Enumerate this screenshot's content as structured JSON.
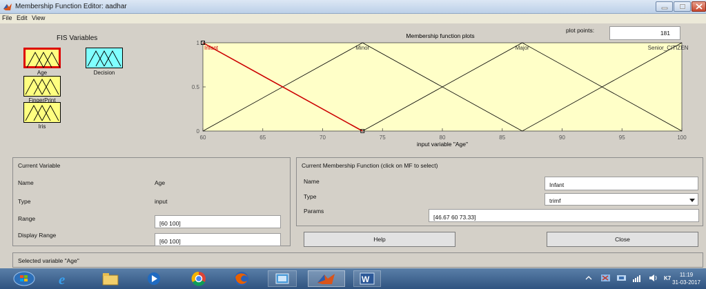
{
  "window": {
    "title": "Membership Function Editor: aadhar",
    "icons": {
      "app": "matlab-icon",
      "minimize": "minimize-icon",
      "maximize": "maximize-icon",
      "close": "close-icon"
    }
  },
  "menu": {
    "items": [
      "File",
      "Edit",
      "View"
    ]
  },
  "fis": {
    "title": "FIS Variables",
    "variables": [
      {
        "label": "Age",
        "selected": true,
        "color": "#ffff80",
        "kind": "input"
      },
      {
        "label": "Decision",
        "selected": false,
        "color": "#80ffff",
        "kind": "output"
      },
      {
        "label": "FingerPrint",
        "selected": false,
        "color": "#ffff80",
        "kind": "input"
      },
      {
        "label": "Iris",
        "selected": false,
        "color": "#ffff80",
        "kind": "input"
      }
    ]
  },
  "plot_points": {
    "label": "plot points:",
    "value": "181"
  },
  "chart_data": {
    "type": "line",
    "title": "Membership function plots",
    "xlabel": "input variable \"Age\"",
    "ylabel": "",
    "xlim": [
      60,
      100
    ],
    "ylim": [
      0,
      1
    ],
    "x_ticks": [
      "60",
      "65",
      "70",
      "75",
      "80",
      "85",
      "90",
      "95",
      "100"
    ],
    "y_ticks": [
      "0",
      "0.5",
      "1"
    ],
    "background": "#ffffc8",
    "series": [
      {
        "name": "Infant",
        "params": [
          46.67,
          60,
          73.33
        ],
        "color": "#cc0000",
        "selected": true
      },
      {
        "name": "Minor",
        "params": [
          60,
          73.33,
          86.67
        ],
        "color": "#000000",
        "selected": false
      },
      {
        "name": "Major",
        "params": [
          73.33,
          86.67,
          100
        ],
        "color": "#000000",
        "selected": false
      },
      {
        "name": "Senior_CITIZEN",
        "params": [
          86.67,
          100,
          113.3
        ],
        "color": "#000000",
        "selected": false
      }
    ],
    "label_texts": [
      "Infant",
      "Minor",
      "Major",
      "Senior_CITIZEN"
    ]
  },
  "current_variable": {
    "title": "Current Variable",
    "name_label": "Name",
    "name_value": "Age",
    "type_label": "Type",
    "type_value": "input",
    "range_label": "Range",
    "range_value": "[60 100]",
    "display_range_label": "Display Range",
    "display_range_value": "[60 100]"
  },
  "current_mf": {
    "title": "Current Membership Function (click on MF to select)",
    "name_label": "Name",
    "name_value": "Infant",
    "type_label": "Type",
    "type_value": "trimf",
    "params_label": "Params",
    "params_value": "[46.67 60 73.33]",
    "help_label": "Help",
    "close_label": "Close"
  },
  "status": {
    "text": "Selected variable \"Age\""
  },
  "taskbar": {
    "icons": [
      "start-orb-icon",
      "internet-explorer-icon",
      "file-explorer-icon",
      "media-player-icon",
      "chrome-icon",
      "firefox-icon",
      "window-manager-icon",
      "matlab-taskbar-icon",
      "word-icon"
    ],
    "tray": {
      "k7": "K7",
      "time": "11:19",
      "date": "31-03-2017"
    }
  }
}
